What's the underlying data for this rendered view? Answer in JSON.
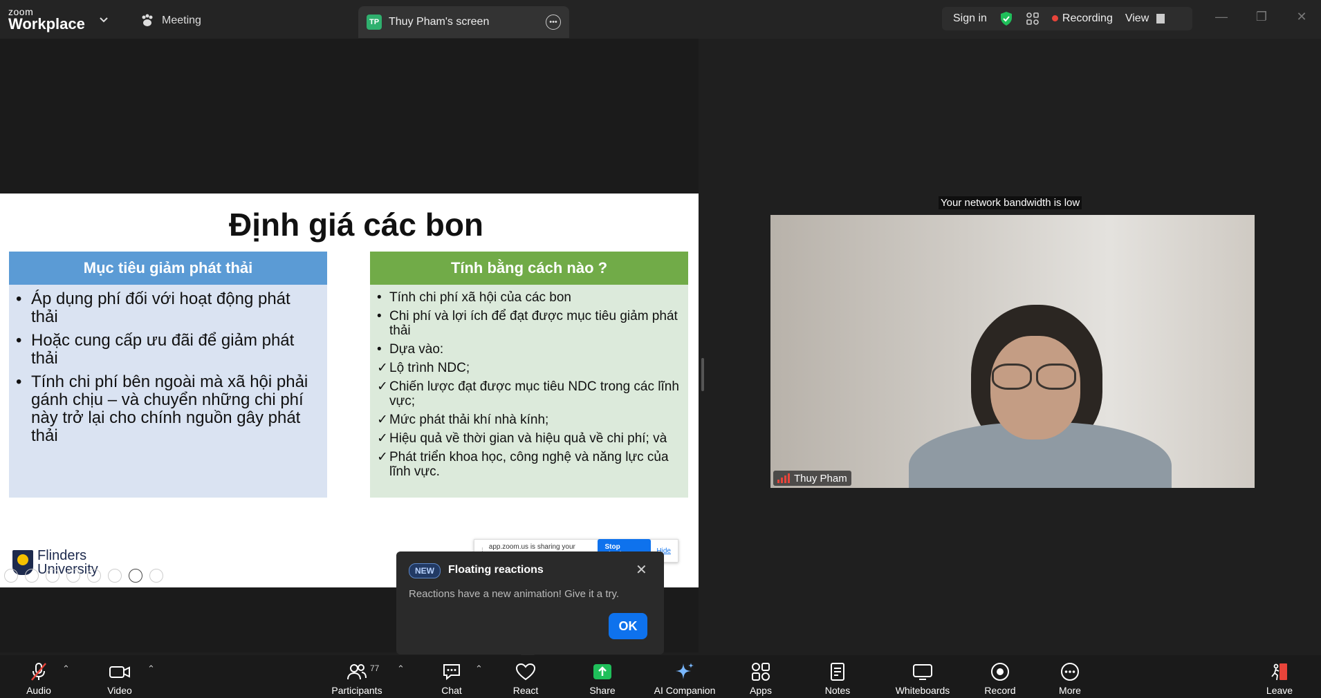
{
  "titlebar": {
    "logo_line1": "zoom",
    "logo_line2": "Workplace",
    "meeting_label": "Meeting",
    "tab_badge": "TP",
    "tab_title": "Thuy Pham's screen",
    "sign_in": "Sign in",
    "recording": "Recording",
    "view": "View"
  },
  "slide": {
    "title": "Định giá các bon",
    "left_panel": {
      "heading": "Mục tiêu giảm phát thải",
      "bullets": [
        "Áp dụng phí đối với hoạt động phát thải",
        "Hoặc cung cấp ưu đãi để giảm phát thải",
        "Tính chi phí bên ngoài mà xã hội phải gánh chịu – và chuyển những chi phí này trở lại cho chính nguồn gây phát thải"
      ]
    },
    "right_panel": {
      "heading": "Tính bằng cách nào ?",
      "items": [
        {
          "marker": "•",
          "text": "Tính chi phí xã hội của các bon"
        },
        {
          "marker": "•",
          "text": "Chi phí và lợi ích để đạt được mục tiêu giảm phát thải"
        },
        {
          "marker": "•",
          "text": "Dựa vào:"
        },
        {
          "marker": "✓",
          "text": "Lộ trình NDC;"
        },
        {
          "marker": "✓",
          "text": "Chiến lược đạt được mục tiêu NDC trong các lĩnh vực;"
        },
        {
          "marker": "✓",
          "text": "Mức phát thải khí nhà kính;"
        },
        {
          "marker": "✓",
          "text": "Hiệu quả về thời gian và hiệu quả về chi phí; và"
        },
        {
          "marker": "✓",
          "text": "Phát triển khoa học, công nghệ và năng lực của lĩnh vực."
        }
      ]
    },
    "logo_line1": "Flinders",
    "logo_line2": "University",
    "sharing_bar": {
      "message": "app.zoom.us is sharing your screen.",
      "stop": "Stop sharing",
      "hide": "Hide"
    }
  },
  "video": {
    "bandwidth_notice": "Your network bandwidth is low",
    "participant_name": "Thuy Pham"
  },
  "popup": {
    "badge": "NEW",
    "title": "Floating reactions",
    "body": "Reactions have a new animation! Give it a try.",
    "ok": "OK"
  },
  "toolbar": {
    "audio": "Audio",
    "video": "Video",
    "participants": "Participants",
    "participants_count": "77",
    "chat": "Chat",
    "react": "React",
    "share": "Share",
    "ai_companion": "AI Companion",
    "apps": "Apps",
    "notes": "Notes",
    "whiteboards": "Whiteboards",
    "record": "Record",
    "more": "More",
    "leave": "Leave"
  },
  "colors": {
    "accent_blue": "#0e72ed",
    "recording_red": "#e8443a",
    "share_green": "#1fbf5a",
    "slide_left_head": "#5b9bd5",
    "slide_right_head": "#71ab48"
  }
}
